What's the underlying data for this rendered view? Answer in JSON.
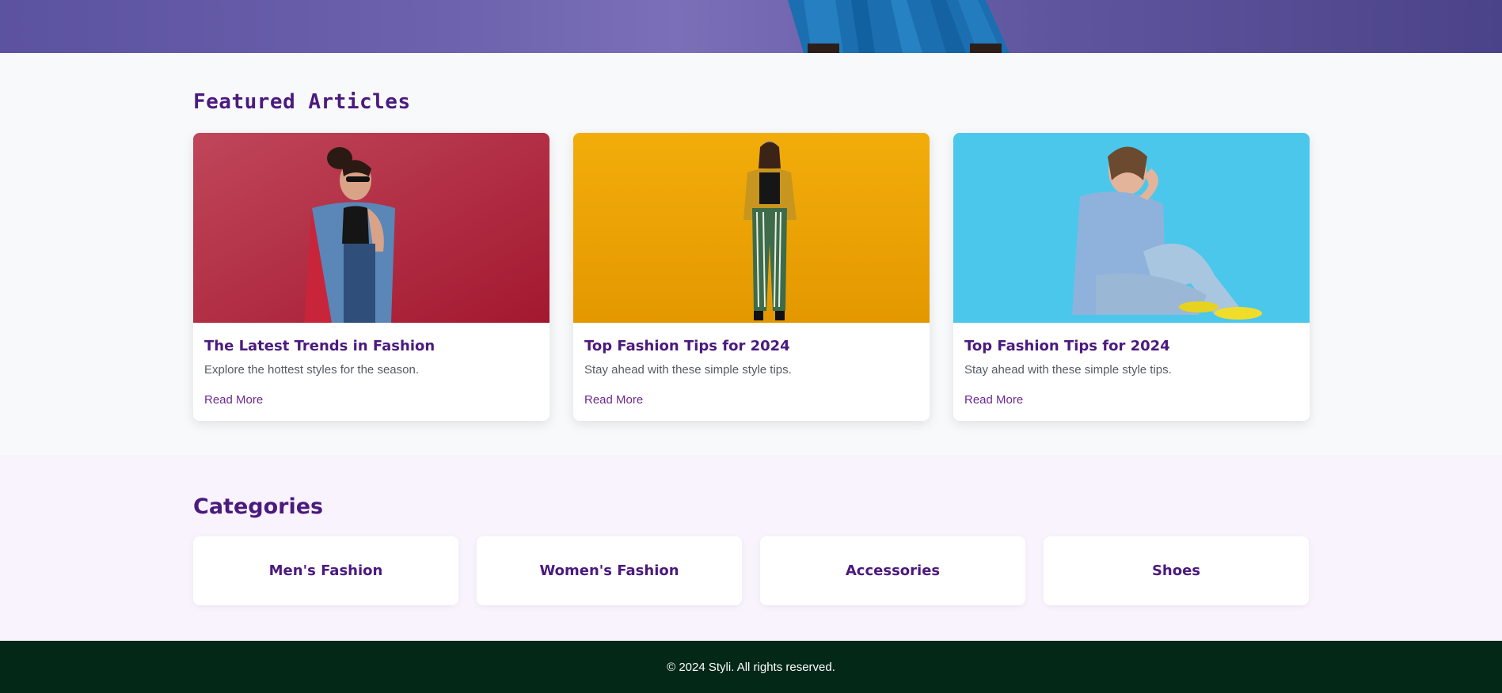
{
  "hero": {
    "image": "fashion-hero-photo"
  },
  "featured": {
    "title": "Featured Articles",
    "articles": [
      {
        "title": "The Latest Trends in Fashion",
        "description": "Explore the hottest styles for the season.",
        "link_label": "Read More",
        "image": "woman-denim-jacket-red-background",
        "bg_color": "#b8304a"
      },
      {
        "title": "Top Fashion Tips for 2024",
        "description": "Stay ahead with these simple style tips.",
        "link_label": "Read More",
        "image": "woman-striped-pants-yellow-background",
        "bg_color": "#f0a500"
      },
      {
        "title": "Top Fashion Tips for 2024",
        "description": "Stay ahead with these simple style tips.",
        "link_label": "Read More",
        "image": "woman-sitting-denim-blue-background",
        "bg_color": "#4cc7ec"
      }
    ]
  },
  "categories": {
    "title": "Categories",
    "items": [
      {
        "label": "Men's Fashion"
      },
      {
        "label": "Women's Fashion"
      },
      {
        "label": "Accessories"
      },
      {
        "label": "Shoes"
      }
    ]
  },
  "footer": {
    "copyright": "© 2024 Styli. All rights reserved."
  },
  "colors": {
    "accent": "#4b1a7e",
    "footer_bg": "#032817",
    "categories_bg": "#f9f3fd"
  }
}
